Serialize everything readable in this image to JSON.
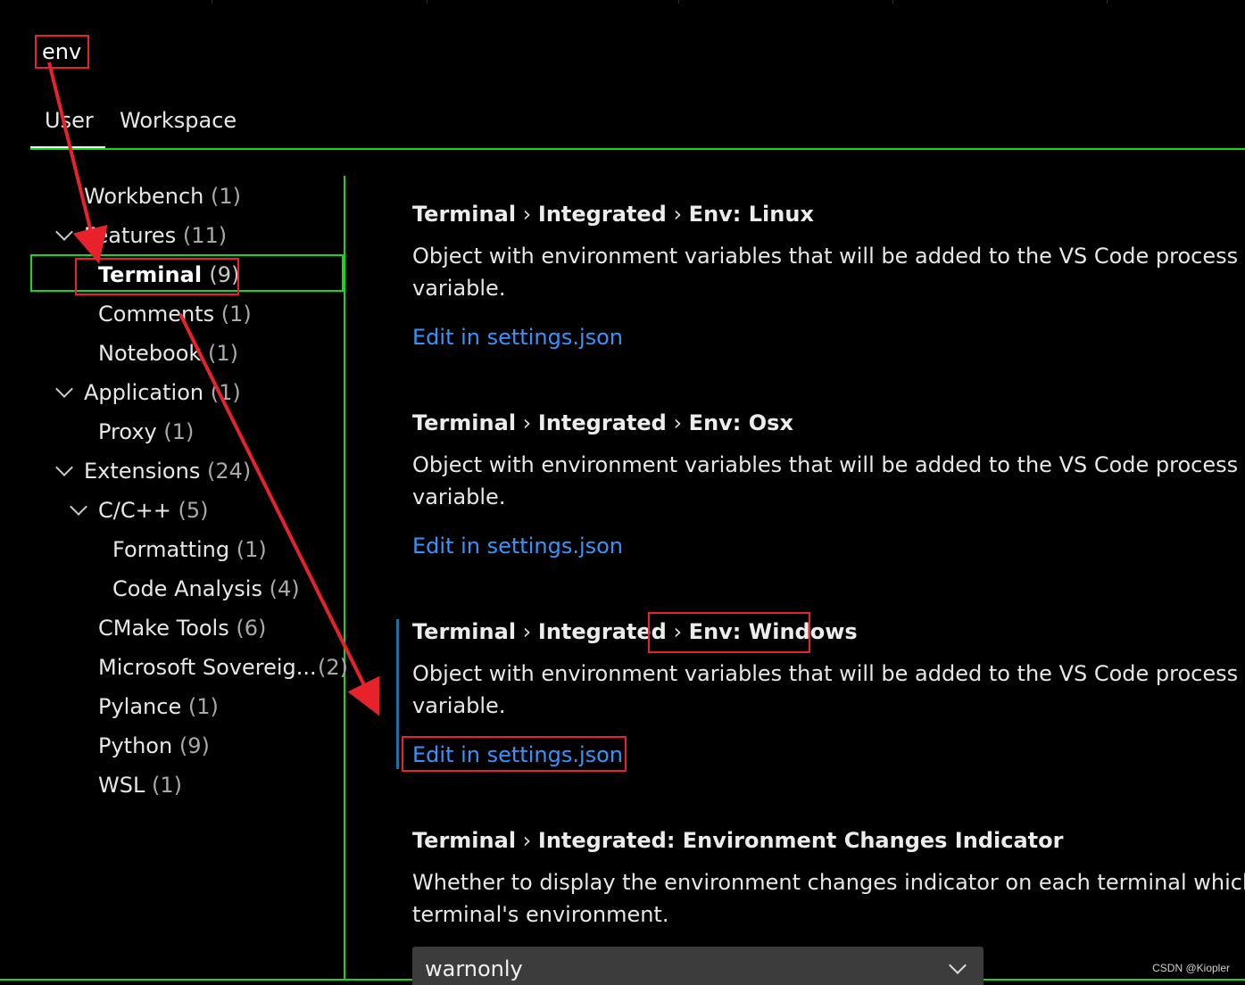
{
  "search": {
    "query": "env"
  },
  "scope_tabs": [
    {
      "label": "User",
      "active": true
    },
    {
      "label": "Workspace",
      "active": false
    }
  ],
  "toc": {
    "workbench": {
      "label": "Workbench",
      "count": "(1)"
    },
    "features": {
      "label": "Features",
      "count": "(11)"
    },
    "terminal": {
      "label": "Terminal",
      "count": "(9)"
    },
    "comments": {
      "label": "Comments",
      "count": "(1)"
    },
    "notebook": {
      "label": "Notebook",
      "count": "(1)"
    },
    "application": {
      "label": "Application",
      "count": "(1)"
    },
    "proxy": {
      "label": "Proxy",
      "count": "(1)"
    },
    "extensions": {
      "label": "Extensions",
      "count": "(24)"
    },
    "cpp": {
      "label": "C/C++",
      "count": "(5)"
    },
    "formatting": {
      "label": "Formatting",
      "count": "(1)"
    },
    "code_analysis": {
      "label": "Code Analysis",
      "count": "(4)"
    },
    "cmake": {
      "label": "CMake Tools",
      "count": "(6)"
    },
    "ms_sovereign": {
      "label": "Microsoft Sovereig...",
      "count": "(2)"
    },
    "pylance": {
      "label": "Pylance",
      "count": "(1)"
    },
    "python": {
      "label": "Python",
      "count": "(9)"
    },
    "wsl": {
      "label": "WSL",
      "count": "(1)"
    }
  },
  "settings": [
    {
      "category": "Terminal",
      "sep1": " › ",
      "subcategory": "Integrated",
      "sep2": " › ",
      "name": "Env: Linux",
      "desc_line1": "Object with environment variables that will be added to the VS Code process to b",
      "desc_line2": "variable.",
      "link": "Edit in settings.json"
    },
    {
      "category": "Terminal",
      "sep1": " › ",
      "subcategory": "Integrated",
      "sep2": " › ",
      "name": "Env: Osx",
      "desc_line1": "Object with environment variables that will be added to the VS Code process to b",
      "desc_line2": "variable.",
      "link": "Edit in settings.json"
    },
    {
      "category": "Terminal",
      "sep1": " › ",
      "subcategory": "Integrated",
      "sep2": " › ",
      "name": "Env: Windows",
      "desc_line1": "Object with environment variables that will be added to the VS Code process to b",
      "desc_line2": "variable.",
      "link": "Edit in settings.json"
    },
    {
      "category": "Terminal",
      "sep1": " › ",
      "subcategory": "Integrated: Environment Changes Indicator",
      "desc_line1": "Whether to display the environment changes indicator on each terminal which exp",
      "desc_line2": "terminal's environment.",
      "dropdown_value": "warnonly"
    }
  ],
  "watermark": "CSDN @Kiopler",
  "colors": {
    "annotation_red": "#e8222a",
    "annotation_green": "#16d916",
    "link_blue": "#3794ff",
    "focus_bar": "#1e6fa6",
    "background": "#000000"
  }
}
